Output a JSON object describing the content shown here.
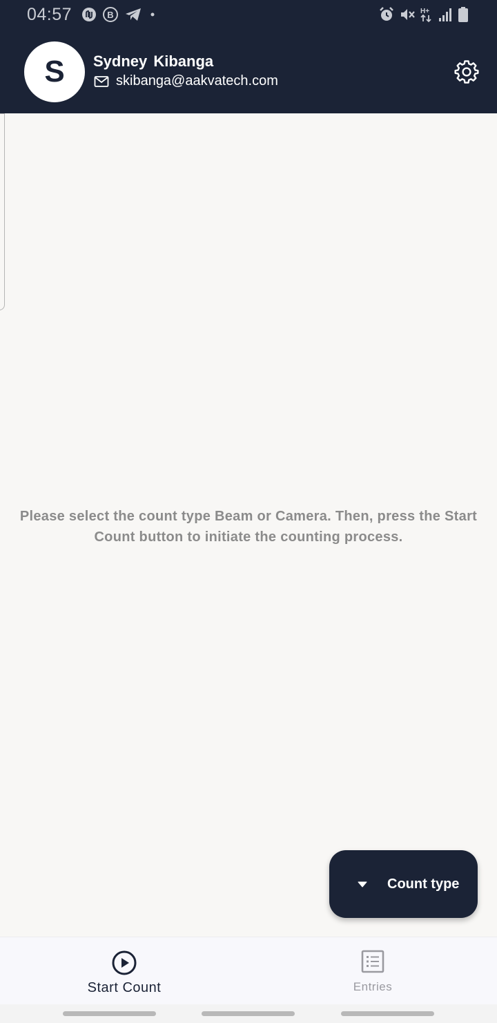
{
  "status_bar": {
    "time": "04:57",
    "left_icons": [
      "nfc-app-icon",
      "b-app-icon",
      "telegram-icon",
      "dot-icon"
    ],
    "right_icons": [
      "alarm-icon",
      "mute-icon",
      "hplus-data-icon",
      "signal-icon",
      "battery-icon"
    ]
  },
  "header": {
    "avatar_initial": "S",
    "user_name": "Sydney Kibanga",
    "user_email": "skibanga@aakvatech.com",
    "settings_icon": "gear-icon"
  },
  "main": {
    "instruction": "Please select the count type Beam or Camera. Then, press the Start Count button to initiate the counting process."
  },
  "fab": {
    "label": "Count type",
    "icon": "caret-down-icon"
  },
  "bottom_nav": {
    "items": [
      {
        "label": "Start Count",
        "icon": "play-circle-icon",
        "active": true
      },
      {
        "label": "Entries",
        "icon": "list-icon",
        "active": false
      }
    ]
  },
  "colors": {
    "primary": "#1b2336",
    "background": "#f8f7f5",
    "muted_text": "#8b8b8b",
    "inactive_nav": "#9a9aa0"
  }
}
